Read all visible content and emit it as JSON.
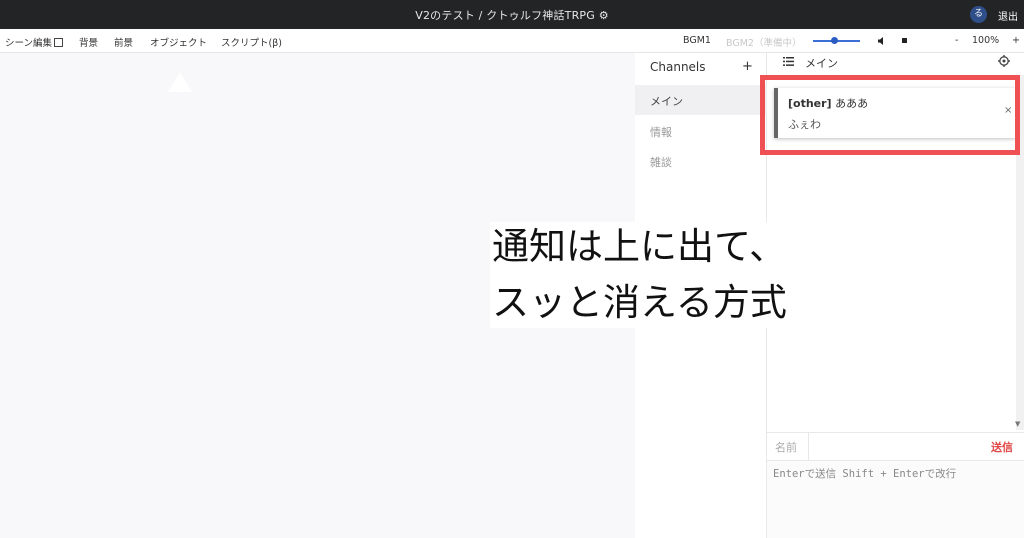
{
  "titlebar": {
    "title": "V2のテスト / クトゥルフ神話TRPG ⚙",
    "avatar_letter": "る",
    "exit_label": "退出"
  },
  "toolbar": {
    "scene_edit_label": "シーン編集",
    "background_label": "背景",
    "foreground_label": "前景",
    "object_label": "オブジェクト",
    "script_label": "スクリプト(β)",
    "bgm1_label": "BGM1",
    "bgm2_label": "BGM2（準備中）",
    "zoom_minus": "-",
    "zoom_value": "100%",
    "zoom_plus": "+",
    "volume_level": 0.45
  },
  "channels": {
    "header": "Channels",
    "add_label": "+",
    "items": [
      {
        "label": "メイン"
      },
      {
        "label": "情報"
      },
      {
        "label": "雑談"
      }
    ]
  },
  "chat": {
    "channel_name": "メイン",
    "notification": {
      "sender": "[other]",
      "title": "あああ",
      "body": "ふぇわ",
      "close": "×"
    },
    "name_label": "名前",
    "send_label": "送信",
    "input_placeholder": "Enterで送信 Shift + Enterで改行"
  },
  "caption": {
    "line1": "通知は上に出て、",
    "line2": "スッと消える方式"
  },
  "colors": {
    "titlebar": "#232425",
    "highlight": "#ef5054",
    "send": "#e04848",
    "slider": "#3b6fd6"
  }
}
